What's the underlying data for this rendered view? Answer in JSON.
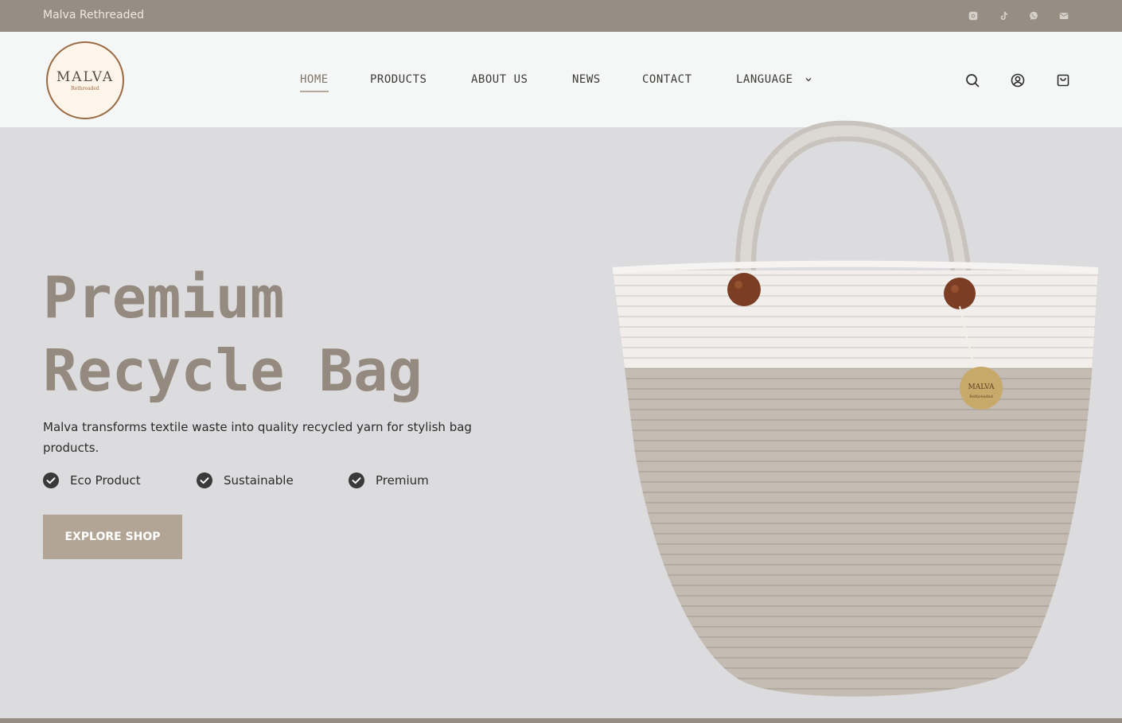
{
  "topbar": {
    "brand": "Malva Rethreaded",
    "socials": [
      "instagram-icon",
      "tiktok-icon",
      "whatsapp-icon",
      "mail-icon"
    ]
  },
  "logo": {
    "name": "MALVA",
    "tagline": "Rethreaded"
  },
  "nav": {
    "items": [
      {
        "label": "HOME",
        "active": true
      },
      {
        "label": "PRODUCTS"
      },
      {
        "label": "ABOUT US"
      },
      {
        "label": "NEWS"
      },
      {
        "label": "CONTACT"
      },
      {
        "label": "LANGUAGE",
        "dropdown": true
      }
    ]
  },
  "header_icons": [
    "search-icon",
    "account-icon",
    "cart-icon"
  ],
  "hero": {
    "title_line1": "Premium",
    "title_line2": "Recycle Bag",
    "description": "Malva transforms textile waste into quality recycled yarn for stylish bag products.",
    "features": [
      "Eco Product",
      "Sustainable",
      "Premium"
    ],
    "cta": "EXPLORE SHOP",
    "tag_text": "MALVA",
    "tag_subtext": "Rethreaded"
  },
  "colors": {
    "topbar": "#978e83",
    "header_bg": "#f5f7f6",
    "hero_bg": "#dcdcde",
    "title": "#958a7f",
    "button": "#b3a595"
  }
}
